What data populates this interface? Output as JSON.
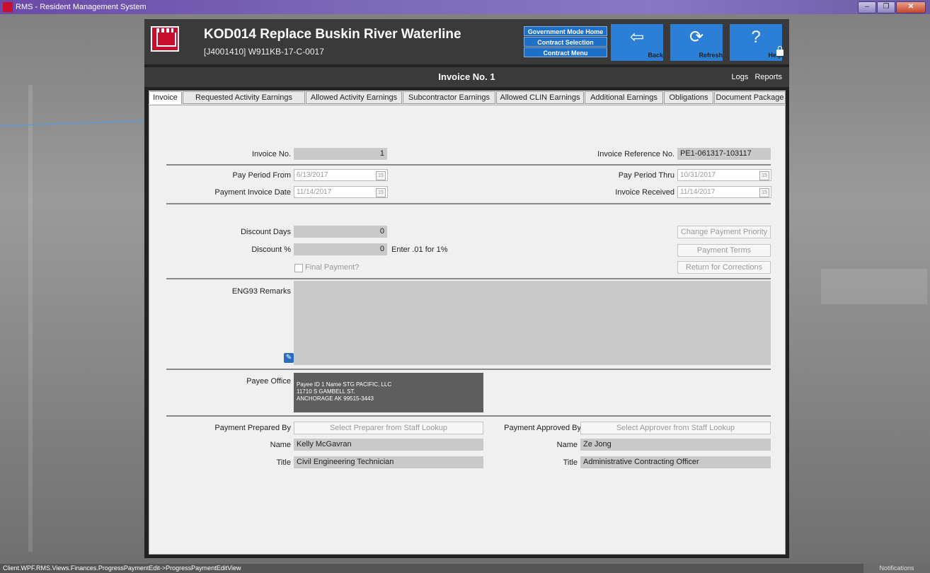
{
  "window": {
    "title": "RMS - Resident Management System"
  },
  "header": {
    "project_title": "KOD014 Replace Buskin River Waterline",
    "project_sub": "[J4001410] W911KB-17-C-0017",
    "nav_links": [
      "Government Mode Home",
      "Contract Selection",
      "Contract Menu"
    ],
    "back_label": "Back",
    "refresh_label": "Refresh",
    "help_label": "Help"
  },
  "subheader": {
    "title": "Invoice No. 1",
    "logs": "Logs",
    "reports": "Reports"
  },
  "tabs": [
    {
      "label": "Invoice"
    },
    {
      "label": "Requested Activity Earnings"
    },
    {
      "label": "Allowed Activity Earnings"
    },
    {
      "label": "Subcontractor Earnings"
    },
    {
      "label": "Allowed CLIN Earnings"
    },
    {
      "label": "Additional Earnings"
    },
    {
      "label": "Obligations"
    },
    {
      "label": "Document Package"
    }
  ],
  "form": {
    "invoice_no_label": "Invoice No.",
    "invoice_no": "1",
    "invoice_ref_label": "Invoice Reference No.",
    "invoice_ref": "PE1-061317-103117",
    "pay_from_label": "Pay Period From",
    "pay_from": "6/13/2017",
    "pay_thru_label": "Pay Period Thru",
    "pay_thru": "10/31/2017",
    "pay_inv_date_label": "Payment Invoice Date",
    "pay_inv_date": "11/14/2017",
    "inv_received_label": "Invoice Received",
    "inv_received": "11/14/2017",
    "cal_glyph": "15",
    "discount_days_label": "Discount Days",
    "discount_days": "0",
    "discount_pct_label": "Discount %",
    "discount_pct": "0",
    "discount_hint": "Enter .01 for 1%",
    "final_payment_label": "Final Payment?",
    "change_priority": "Change Payment Priority",
    "payment_terms": "Payment Terms",
    "return_corrections": "Return for Corrections",
    "remarks_label": "ENG93 Remarks",
    "payee_label": "Payee Office",
    "payee_lines": [
      "Payee ID 1 Name STG PACIFIC, LLC",
      "11710 S GAMBELL ST.",
      "ANCHORAGE AK 99515-3443"
    ],
    "prepared_by_label": "Payment Prepared By",
    "prepared_by_btn": "Select Preparer from Staff Lookup",
    "approved_by_label": "Payment Approved By",
    "approved_by_btn": "Select Approver from Staff Lookup",
    "name_label": "Name",
    "title_label": "Title",
    "prep_name": "Kelly McGavran",
    "prep_title": "Civil Engineering Technician",
    "appr_name": "Ze Jong",
    "appr_title": "Administrative Contracting Officer"
  },
  "statusbar": {
    "path": "Client.WPF.RMS.Views.Finances.ProgressPaymentEdit->ProgressPaymentEditView",
    "notifications": "Notifications"
  },
  "colors": {
    "accent": "#2c7fd6",
    "nav_link": "#1e6fc8",
    "header_bg": "#3a3a3a",
    "brand_red": "#c8102e"
  }
}
